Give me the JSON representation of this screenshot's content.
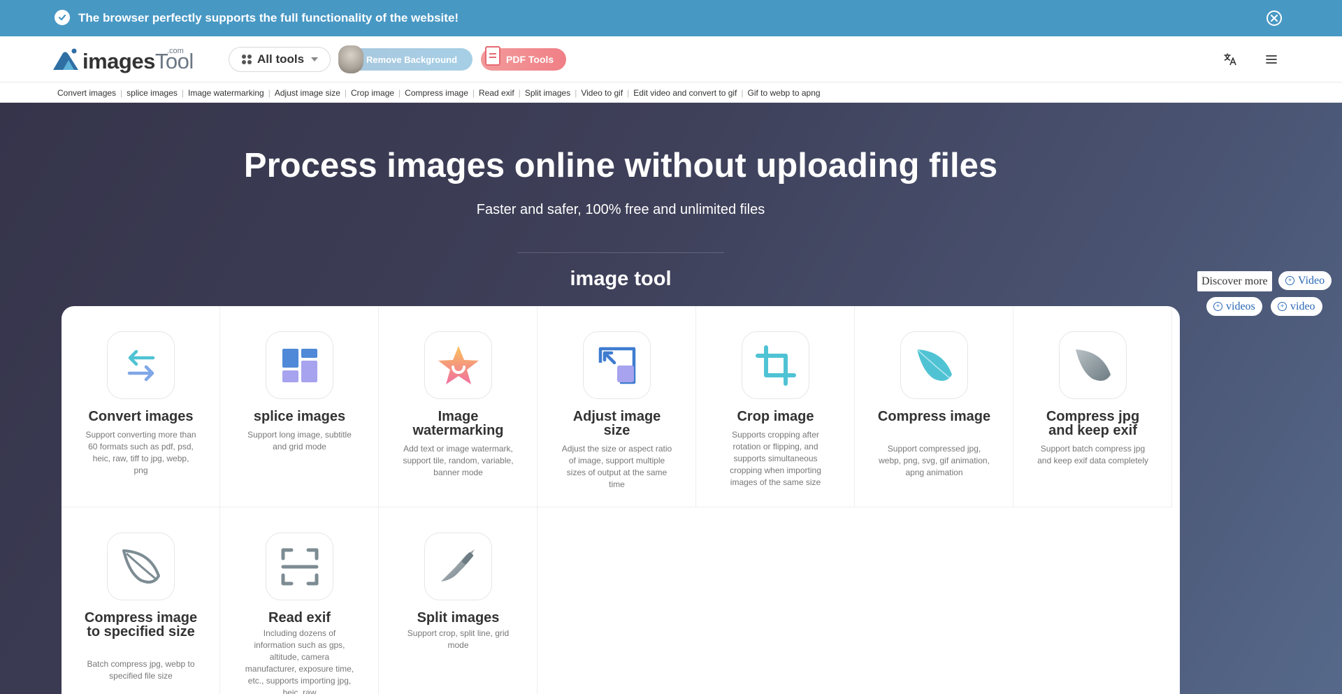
{
  "banner": {
    "message": "The browser perfectly supports the full functionality of the website!",
    "check_icon": "check-circle-icon",
    "close_icon": "close-circle-icon"
  },
  "header": {
    "logo": {
      "word_main": "images",
      "word_tool": "Tool",
      "com": ".com"
    },
    "all_tools_label": "All tools",
    "remove_bg_label": "Remove Background",
    "pdf_tools_label": "PDF Tools",
    "language_icon": "translate-icon",
    "menu_icon": "hamburger-menu-icon"
  },
  "subnav": [
    "Convert images",
    "splice images",
    "Image watermarking",
    "Adjust image size",
    "Crop image",
    "Compress image",
    "Read exif",
    "Split images",
    "Video to gif",
    "Edit video and convert to gif",
    "Gif to webp to apng"
  ],
  "hero": {
    "title": "Process images online without uploading files",
    "subtitle": "Faster and safer, 100% free and unlimited files",
    "section_title": "image tool"
  },
  "side": {
    "discover": "Discover more",
    "pills": [
      "Video",
      "videos",
      "video"
    ]
  },
  "tools": [
    {
      "title": "Convert images",
      "desc": "Support converting more than 60 formats such as pdf, psd, heic, raw, tiff to jpg, webp, png",
      "icon": "arrows-swap-icon"
    },
    {
      "title": "splice images",
      "desc": "Support long image, subtitle and grid mode",
      "icon": "grid-layout-icon"
    },
    {
      "title": "Image watermarking",
      "desc": "Add text or image watermark, support tile, random, variable, banner mode",
      "icon": "star-badge-icon"
    },
    {
      "title": "Adjust image size",
      "desc": "Adjust the size or aspect ratio of image, support multiple sizes of output at the same time",
      "icon": "resize-icon"
    },
    {
      "title": "Crop image",
      "desc": "Supports cropping after rotation or flipping, and supports simultaneous cropping when importing images of the same size",
      "icon": "crop-icon"
    },
    {
      "title": "Compress image",
      "desc": "Support compressed jpg, webp, png, svg, gif animation, apng animation",
      "icon": "feather-icon"
    },
    {
      "title": "Compress jpg and keep exif",
      "desc": "Support batch compress jpg and keep exif data completely",
      "icon": "feather-gray-icon"
    },
    {
      "title": "Compress image to specified size",
      "desc": "Batch compress jpg, webp to specified file size",
      "icon": "feather-outline-icon"
    },
    {
      "title": "Read exif",
      "desc": "Including dozens of information such as gps, altitude, camera manufacturer, exposure time, etc., supports importing jpg, heic, raw",
      "icon": "scan-icon"
    },
    {
      "title": "Split images",
      "desc": "Support crop, split line, grid mode",
      "icon": "knife-icon"
    }
  ]
}
